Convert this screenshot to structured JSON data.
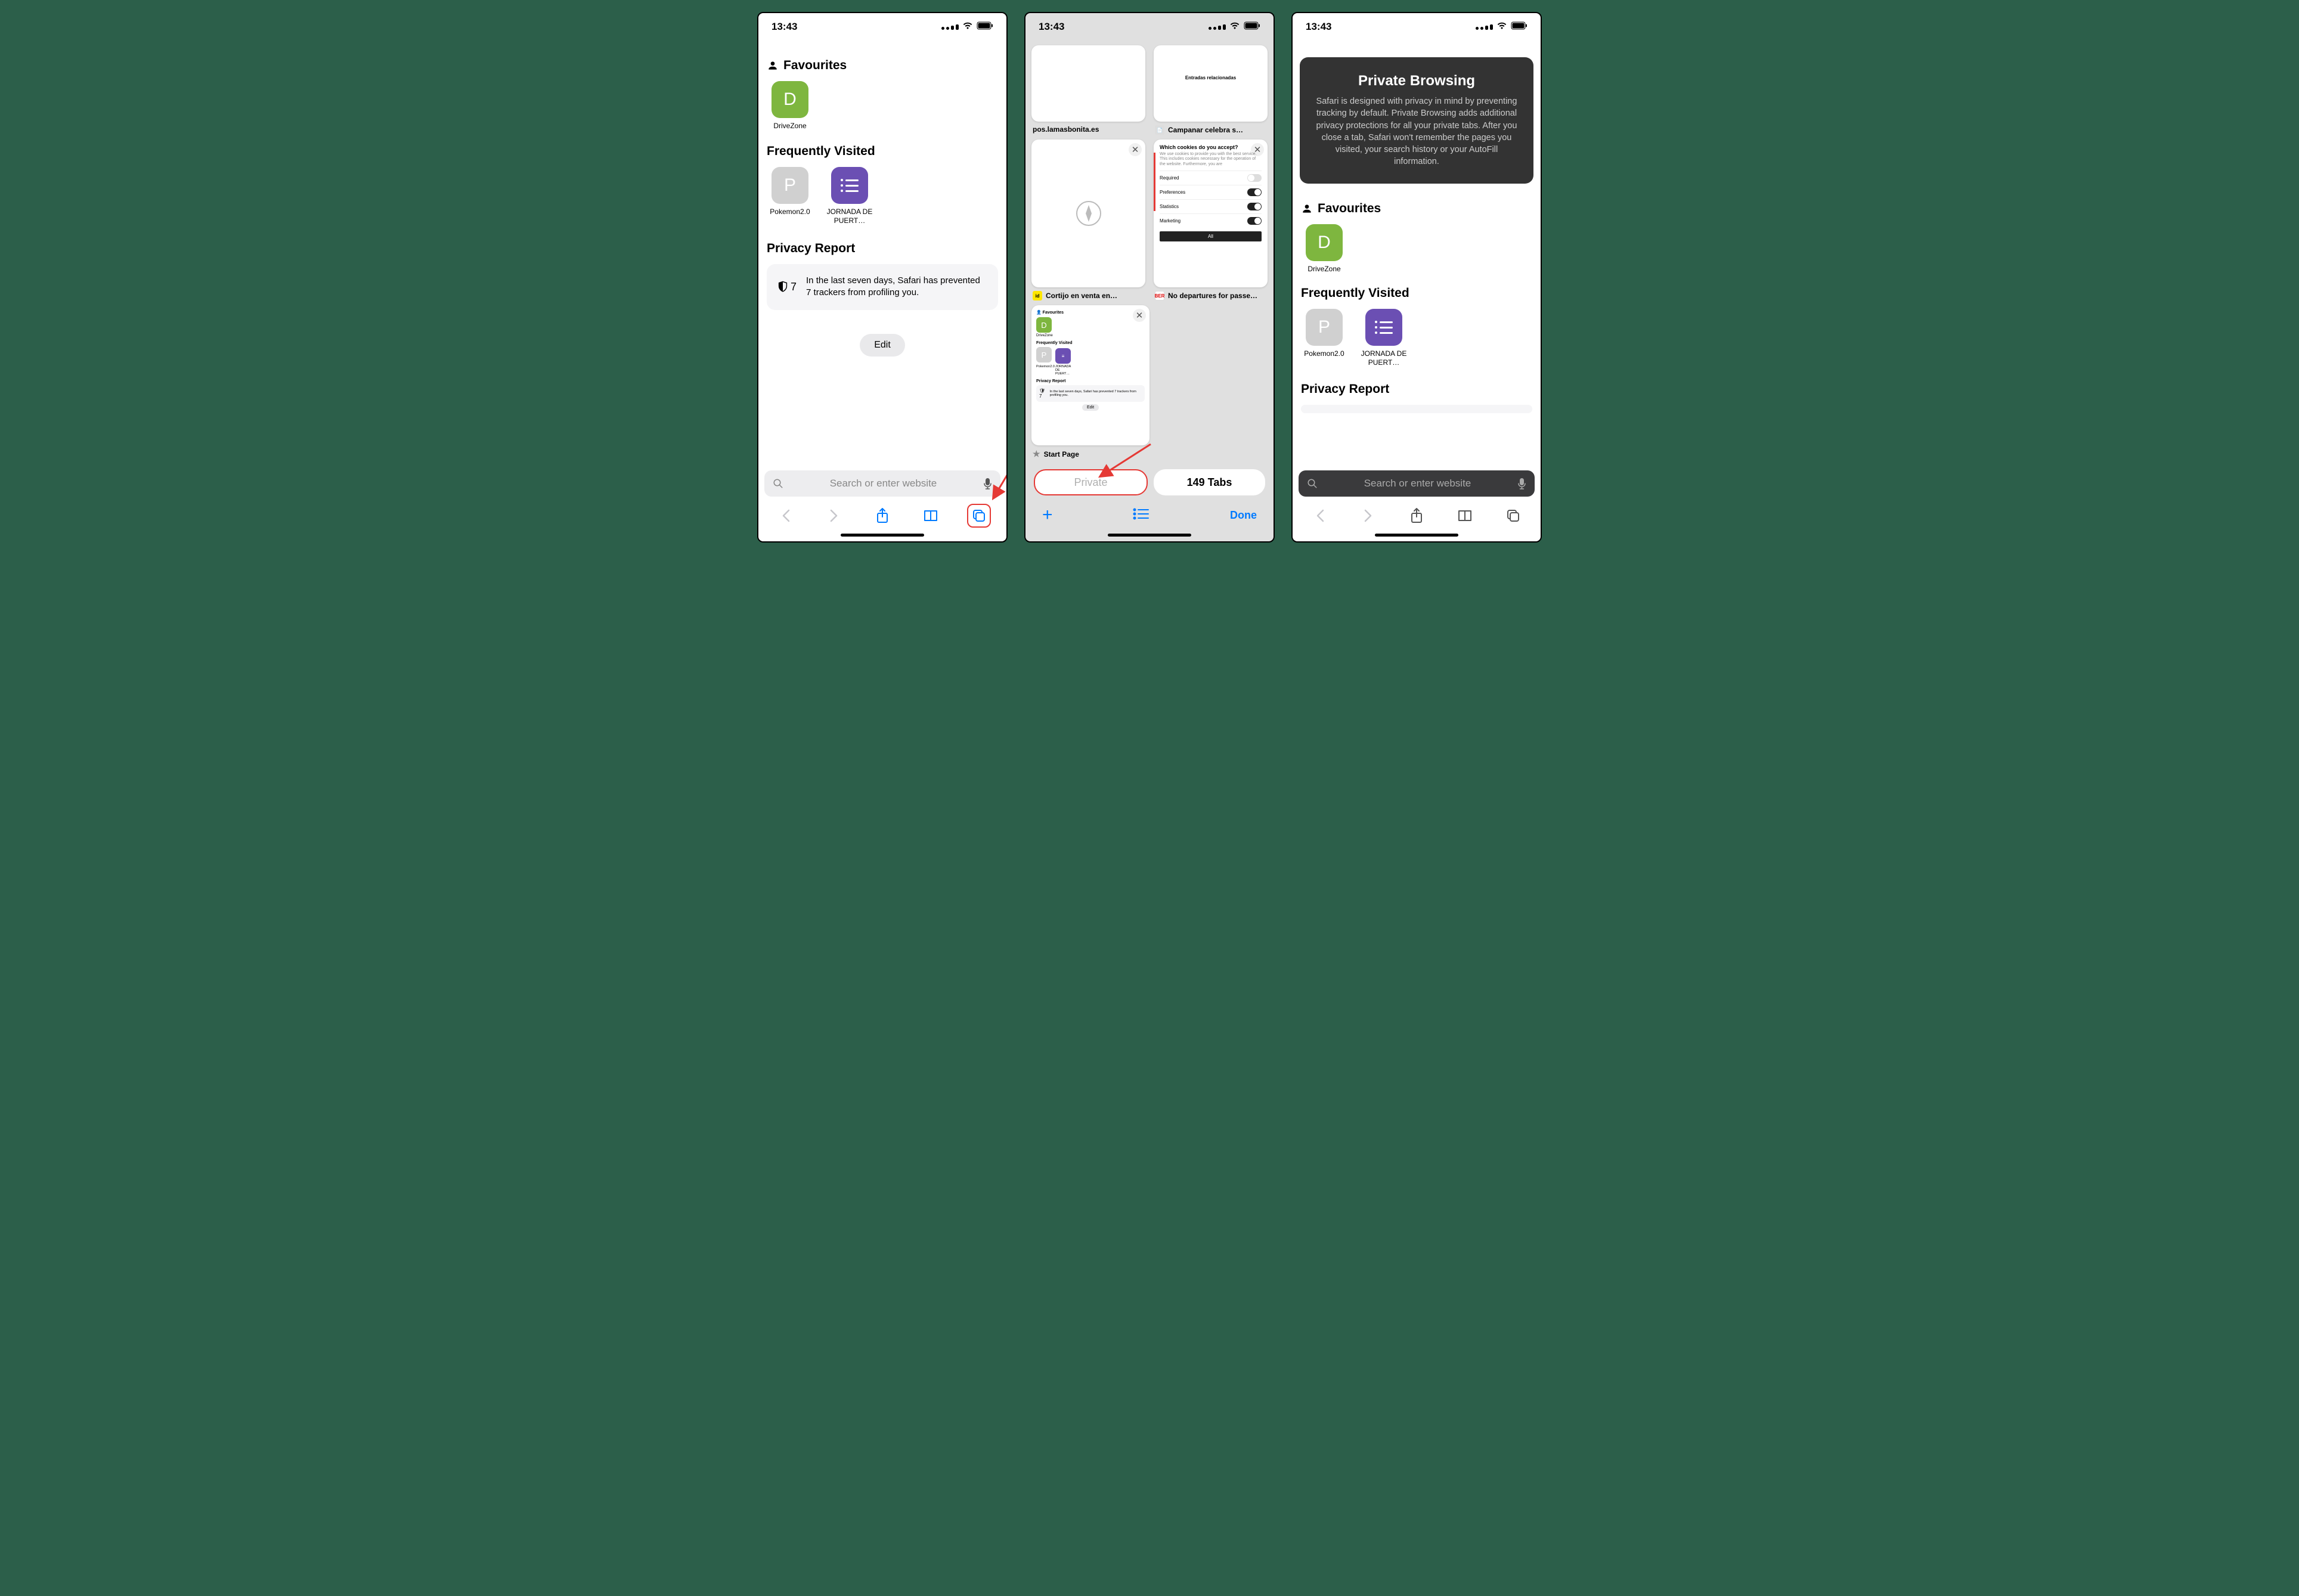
{
  "status": {
    "time": "13:43"
  },
  "panel1": {
    "favourites_header": "Favourites",
    "favourites": [
      {
        "letter": "D",
        "label": "DriveZone",
        "color": "green"
      }
    ],
    "freq_header": "Frequently Visited",
    "freq": [
      {
        "letter": "P",
        "label": "Pokemon2.0",
        "color": "grey"
      },
      {
        "letter": "list",
        "label": "JORNADA DE PUERT…",
        "color": "purple"
      }
    ],
    "privacy_header": "Privacy Report",
    "privacy_count": "7",
    "privacy_text": "In the last seven days, Safari has prevented 7 trackers from profiling you.",
    "edit_label": "Edit",
    "search_placeholder": "Search or enter website"
  },
  "panel2": {
    "tabs_row1": [
      {
        "title": "pos.lamasbonita.es",
        "favicon": ""
      },
      {
        "title": "Campanar celebra s…",
        "favicon": "img",
        "thumb_text": "Entradas relacionadas"
      }
    ],
    "tabs_row2": [
      {
        "title": "Cortijo en venta en…",
        "favicon": "id",
        "favicon_bg": "#ffe600",
        "favicon_color": "#000"
      },
      {
        "title": "No departures for passe…",
        "favicon": "BER",
        "favicon_bg": "#fff",
        "favicon_color": "#d00",
        "cookies": {
          "heading": "Which cookies do you accept?",
          "sub": "We use cookies to provide you with the best service. This includes cookies necessary for the operation of the website. Furthermore, you are",
          "rows": [
            {
              "label": "Required",
              "on": false
            },
            {
              "label": "Preferences",
              "on": true
            },
            {
              "label": "Statistics",
              "on": true
            },
            {
              "label": "Marketing",
              "on": true
            }
          ],
          "all": "All"
        }
      }
    ],
    "tabs_row3": [
      {
        "title": "Start Page",
        "favicon": "star",
        "startpage": {
          "fav": "Favourites",
          "dz": "DriveZone",
          "freq": "Frequently Visited",
          "p": "Pokemon2.0",
          "j": "JORNADA DE PUERT…",
          "pr": "Privacy Report",
          "pr_num": "7",
          "pr_text": "In the last seven days, Safari has prevented 7 trackers from profiling you.",
          "edit": "Edit"
        }
      }
    ],
    "mode_private": "Private",
    "mode_tabs": "149 Tabs",
    "done": "Done"
  },
  "panel3": {
    "pb_title": "Private Browsing",
    "pb_body": "Safari is designed with privacy in mind by preventing tracking by default. Private Browsing adds additional privacy protections for all your private tabs. After you close a tab, Safari won't remember the pages you visited, your search history or your AutoFill information.",
    "favourites_header": "Favourites",
    "favourites": [
      {
        "letter": "D",
        "label": "DriveZone"
      }
    ],
    "freq_header": "Frequently Visited",
    "freq": [
      {
        "letter": "P",
        "label": "Pokemon2.0"
      },
      {
        "label": "JORNADA DE PUERT…"
      }
    ],
    "privacy_header": "Privacy Report",
    "search_placeholder": "Search or enter website"
  }
}
